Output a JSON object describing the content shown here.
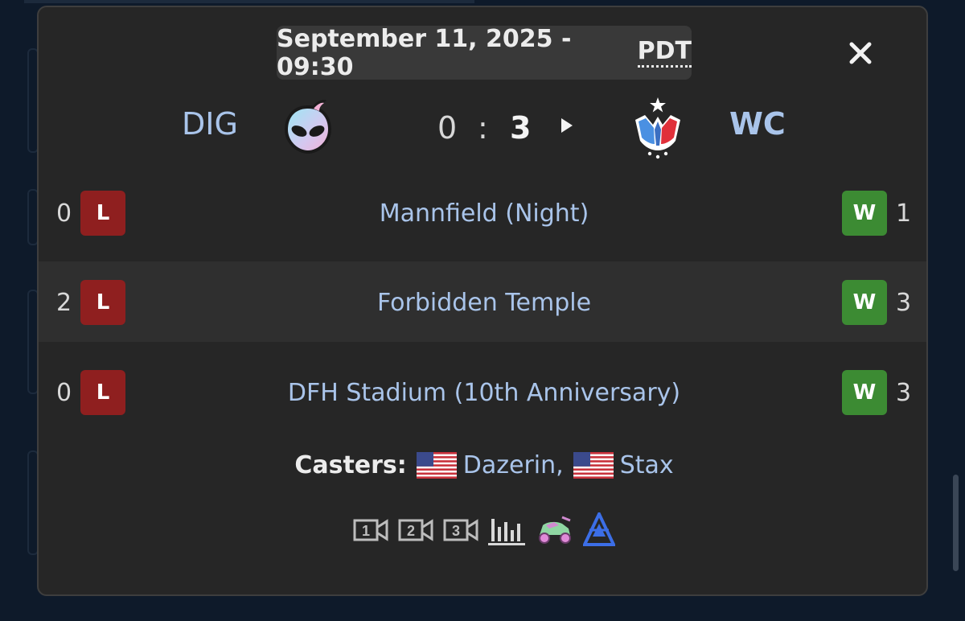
{
  "match": {
    "date": "September 11, 2025 - 09:30",
    "timezone": "PDT",
    "close_icon": "close-icon"
  },
  "teams": {
    "left": {
      "name": "DIG",
      "logo": "alien-logo"
    },
    "right": {
      "name": "WC",
      "logo": "crown-star-logo"
    }
  },
  "score": {
    "left": "0",
    "separator": ":",
    "right": "3"
  },
  "games": [
    {
      "left_score": "0",
      "left_result": "L",
      "map": "Mannfield (Night)",
      "right_result": "W",
      "right_score": "1"
    },
    {
      "left_score": "2",
      "left_result": "L",
      "map": "Forbidden Temple",
      "right_result": "W",
      "right_score": "3"
    },
    {
      "left_score": "0",
      "left_result": "L",
      "map": "DFH Stadium (10th Anniversary)",
      "right_result": "W",
      "right_score": "3"
    }
  ],
  "casters": {
    "label": "Casters:",
    "list": [
      {
        "name": "Dazerin,",
        "flag": "us-flag"
      },
      {
        "name": "Stax",
        "flag": "us-flag"
      }
    ]
  },
  "media": {
    "vod1": "1",
    "vod2": "2",
    "vod3": "3",
    "icons": [
      "video-camera-icon",
      "video-camera-icon",
      "video-camera-icon",
      "stats-icon",
      "car-icon",
      "blast-logo"
    ]
  },
  "colors": {
    "loss": "#8f1f1f",
    "win": "#3c8b33",
    "team_text": "#a9c4ea",
    "panel": "#262626"
  }
}
